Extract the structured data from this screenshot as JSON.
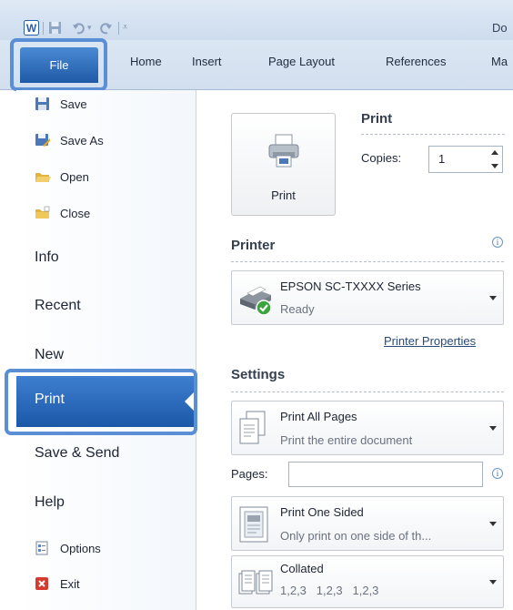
{
  "titlebar": {
    "doc_title": "Do"
  },
  "ribbon": {
    "tabs": [
      {
        "label": "File"
      },
      {
        "label": "Home"
      },
      {
        "label": "Insert"
      },
      {
        "label": "Page Layout"
      },
      {
        "label": "References"
      },
      {
        "label": "Ma"
      }
    ]
  },
  "backstage": {
    "commands": [
      {
        "label": "Save",
        "icon": "save-icon"
      },
      {
        "label": "Save As",
        "icon": "save-as-icon"
      },
      {
        "label": "Open",
        "icon": "open-folder-icon"
      },
      {
        "label": "Close",
        "icon": "close-folder-icon"
      }
    ],
    "pages": [
      {
        "label": "Info"
      },
      {
        "label": "Recent"
      },
      {
        "label": "New"
      },
      {
        "label": "Print"
      },
      {
        "label": "Save & Send"
      },
      {
        "label": "Help"
      }
    ],
    "bottom": [
      {
        "label": "Options",
        "icon": "options-icon"
      },
      {
        "label": "Exit",
        "icon": "exit-icon"
      }
    ],
    "selected": "Print"
  },
  "print_pane": {
    "heading": "Print",
    "print_button_label": "Print",
    "copies_label": "Copies:",
    "copies_value": "1",
    "printer_heading": "Printer",
    "printer_name": "EPSON SC-TXXXX Series",
    "printer_status": "Ready",
    "printer_properties": "Printer Properties",
    "settings_heading": "Settings",
    "pages_label": "Pages:",
    "pages_value": "",
    "settings": [
      {
        "title": "Print All Pages",
        "subtitle": "Print the entire document"
      },
      {
        "title": "Print One Sided",
        "subtitle": "Only print on one side of th..."
      },
      {
        "title": "Collated",
        "subtitle": "1,2,3   1,2,3   1,2,3"
      }
    ]
  },
  "colors": {
    "accent": "#1f5aa7",
    "highlight_box": "#5a8fd6",
    "status_ok": "#3aa53a"
  }
}
